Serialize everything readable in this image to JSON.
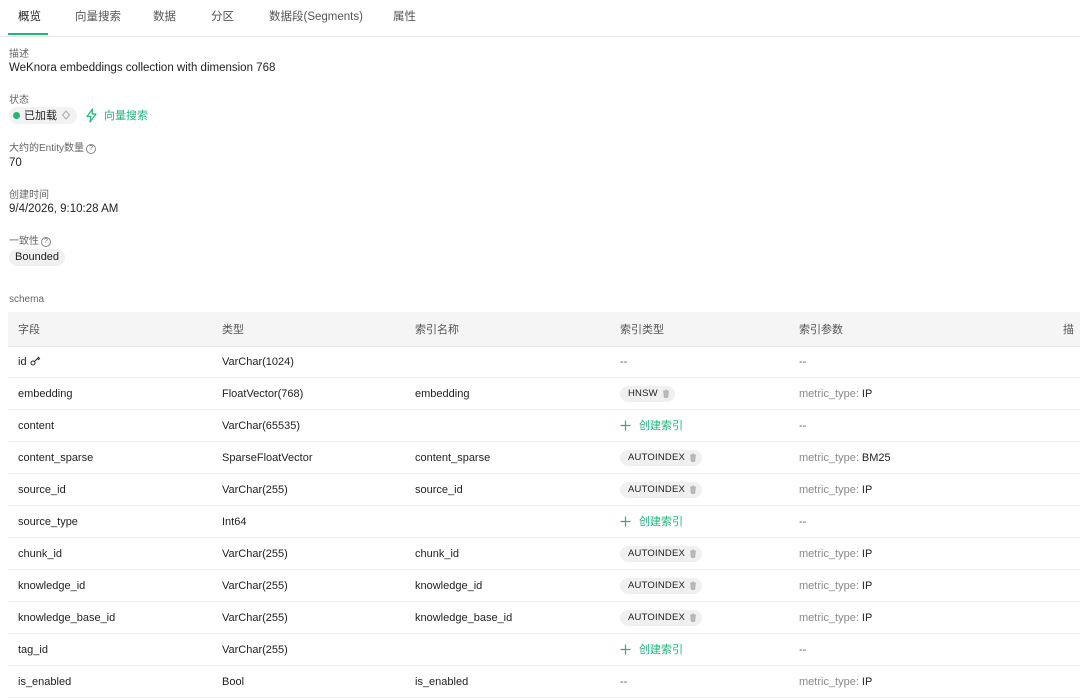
{
  "tabs": [
    {
      "label": "概览",
      "active": true
    },
    {
      "label": "向量搜索"
    },
    {
      "label": "数据"
    },
    {
      "label": "分区"
    },
    {
      "label": "数据段(Segments)"
    },
    {
      "label": "属性"
    }
  ],
  "description": {
    "label": "描述",
    "value": "WeKnora embeddings collection with dimension 768"
  },
  "status": {
    "label": "状态",
    "value": "已加载",
    "search_link": "向量搜索",
    "dot_color": "#22b573"
  },
  "entity_count": {
    "label": "大约的Entity数量",
    "value": "70"
  },
  "created_time": {
    "label": "创建时间",
    "value": "9/4/2026, 9:10:28 AM"
  },
  "consistency": {
    "label": "一致性",
    "value": "Bounded"
  },
  "schema": {
    "title": "schema",
    "columns": [
      "字段",
      "类型",
      "索引名称",
      "索引类型",
      "索引参数",
      "描"
    ],
    "create_index_label": "创建索引",
    "rows": [
      {
        "field": "id",
        "type": "VarChar(1024)",
        "index_name": "",
        "index_type": "--",
        "param_key": "",
        "param_val": "--",
        "primary": true
      },
      {
        "field": "embedding",
        "type": "FloatVector(768)",
        "index_name": "embedding",
        "index_type": "HNSW",
        "param_key": "metric_type:",
        "param_val": "IP"
      },
      {
        "field": "content",
        "type": "VarChar(65535)",
        "index_name": "",
        "index_type": "",
        "create": true,
        "param_key": "",
        "param_val": "--"
      },
      {
        "field": "content_sparse",
        "type": "SparseFloatVector",
        "index_name": "content_sparse",
        "index_type": "AUTOINDEX",
        "param_key": "metric_type:",
        "param_val": "BM25"
      },
      {
        "field": "source_id",
        "type": "VarChar(255)",
        "index_name": "source_id",
        "index_type": "AUTOINDEX",
        "param_key": "metric_type:",
        "param_val": "IP"
      },
      {
        "field": "source_type",
        "type": "Int64",
        "index_name": "",
        "index_type": "",
        "create": true,
        "param_key": "",
        "param_val": "--"
      },
      {
        "field": "chunk_id",
        "type": "VarChar(255)",
        "index_name": "chunk_id",
        "index_type": "AUTOINDEX",
        "param_key": "metric_type:",
        "param_val": "IP"
      },
      {
        "field": "knowledge_id",
        "type": "VarChar(255)",
        "index_name": "knowledge_id",
        "index_type": "AUTOINDEX",
        "param_key": "metric_type:",
        "param_val": "IP"
      },
      {
        "field": "knowledge_base_id",
        "type": "VarChar(255)",
        "index_name": "knowledge_base_id",
        "index_type": "AUTOINDEX",
        "param_key": "metric_type:",
        "param_val": "IP"
      },
      {
        "field": "tag_id",
        "type": "VarChar(255)",
        "index_name": "",
        "index_type": "",
        "create": true,
        "param_key": "",
        "param_val": "--"
      },
      {
        "field": "is_enabled",
        "type": "Bool",
        "index_name": "is_enabled",
        "index_type": "--",
        "param_key": "metric_type:",
        "param_val": "IP"
      }
    ]
  },
  "accent_color": "#1fb77a"
}
